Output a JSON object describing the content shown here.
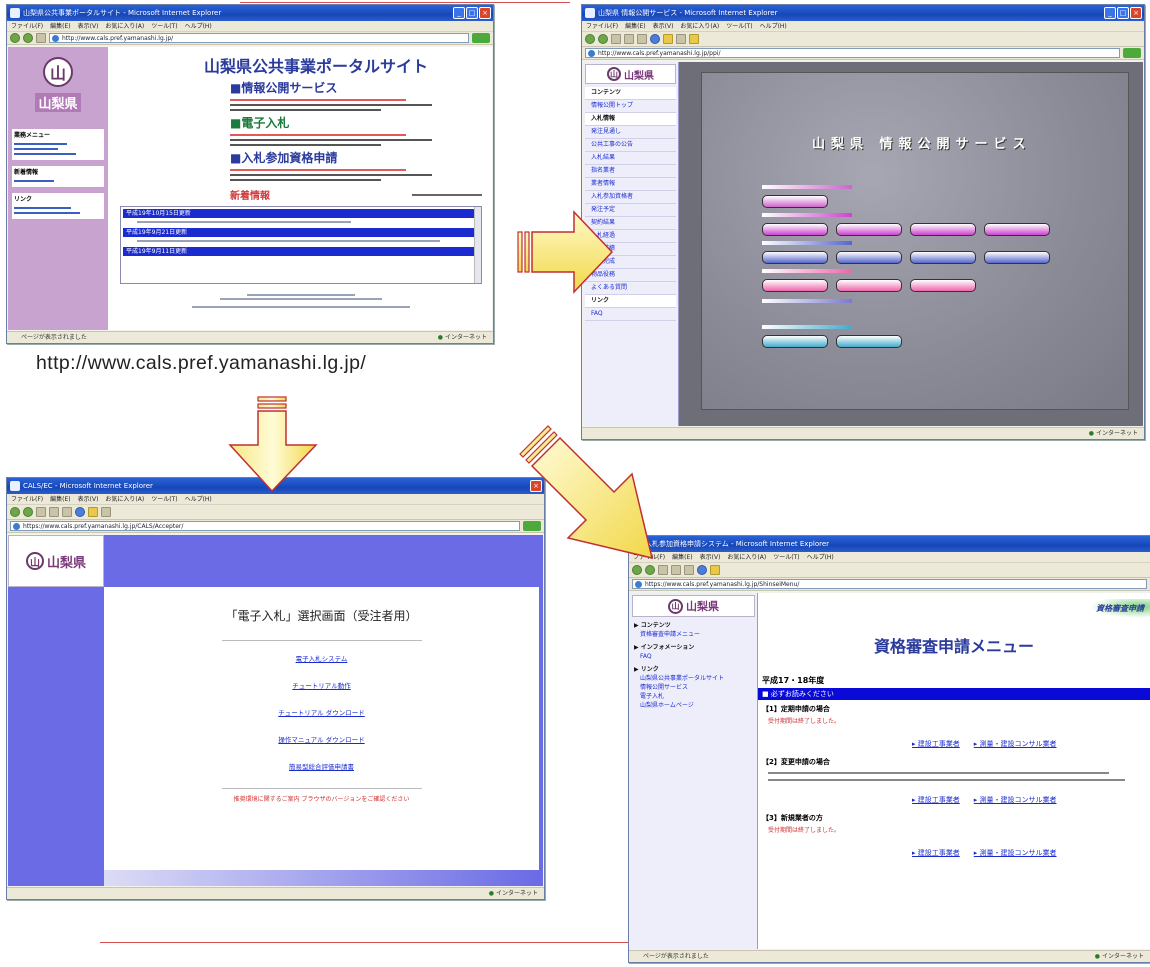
{
  "caption": {
    "url": "http://www.cals.pref.yamanashi.lg.jp/"
  },
  "common": {
    "status_left": "ページが表示されました",
    "status_zone": "インターネット",
    "menu_items": [
      "ファイル(F)",
      "編集(E)",
      "表示(V)",
      "お気に入り(A)",
      "ツール(T)",
      "ヘルプ(H)"
    ],
    "logo_text": "山梨県",
    "logo_mark": "山"
  },
  "win1": {
    "title": "山梨県公共事業ポータルサイト - Microsoft Internet Explorer",
    "address": "http://www.cals.pref.yamanashi.lg.jp/",
    "heading": "山梨県公共事業ポータルサイト",
    "sections": [
      {
        "label": "■情報公開サービス"
      },
      {
        "label": "■電子入札"
      },
      {
        "label": "■入札参加資格申請"
      }
    ],
    "news_title": "新着情報",
    "news_items": [
      "平成19年10月15日更新",
      "平成19年9月21日更新",
      "平成19年9月11日更新"
    ],
    "sidebar_groups": [
      "業務メニュー",
      "新着情報",
      "リンク"
    ]
  },
  "win2": {
    "title": "山梨県 情報公開サービス - Microsoft Internet Explorer",
    "address": "http://www.cals.pref.yamanashi.lg.jp/ppi/",
    "banner": "山梨県 情報公開サービス",
    "sidebar": [
      "コンテンツ",
      "情報公開トップ",
      "入札情報",
      "発注見通し",
      "公共工事の公告",
      "入札結果",
      "指名業者",
      "業者情報",
      "入札参加資格者",
      "発注予定",
      "契約結果",
      "入札経過",
      "工事成績",
      "工事完成",
      "物品役務",
      "よくある質問",
      "リンク",
      "FAQ"
    ]
  },
  "win3": {
    "title": "CALS/EC - Microsoft Internet Explorer",
    "address": "https://www.cals.pref.yamanashi.lg.jp/CALS/Accepter/",
    "heading": "「電子入札」選択画面（受注者用）",
    "links": [
      "電子入札システム",
      "チュートリアル動作",
      "チュートリアル ダウンロード",
      "操作マニュアル ダウンロード",
      "簡易型総合評価申請書"
    ],
    "notice": "推奨環境に関するご案内 ブラウザのバージョンをご確認ください"
  },
  "win4": {
    "title": "入札参加資格申請システム - Microsoft Internet Explorer",
    "address": "https://www.cals.pref.yamanashi.lg.jp/ShinseiMenu/",
    "heading": "資格審査申請メニュー",
    "badge": "資格審査申請",
    "year": "平成17・18年度",
    "notice_bar": "■ 必ずお読みください",
    "sidebar": [
      "コンテンツ",
      "資格審査申請メニュー",
      "インフォメーション",
      "FAQ",
      "リンク",
      "山梨県公共事業ポータルサイト",
      "情報公開サービス",
      "電子入札",
      "山梨県ホームページ"
    ],
    "sections": [
      {
        "title": "【1】定期申請の場合",
        "note": "受付期間は終了しました。",
        "link_a": "建設工事業者",
        "link_b": "測量・建設コンサル業者"
      },
      {
        "title": "【2】変更申請の場合",
        "note": "",
        "link_a": "建設工事業者",
        "link_b": "測量・建設コンサル業者"
      },
      {
        "title": "【3】新規業者の方",
        "note": "受付期間は終了しました。",
        "link_a": "建設工事業者",
        "link_b": "測量・建設コンサル業者"
      }
    ]
  }
}
